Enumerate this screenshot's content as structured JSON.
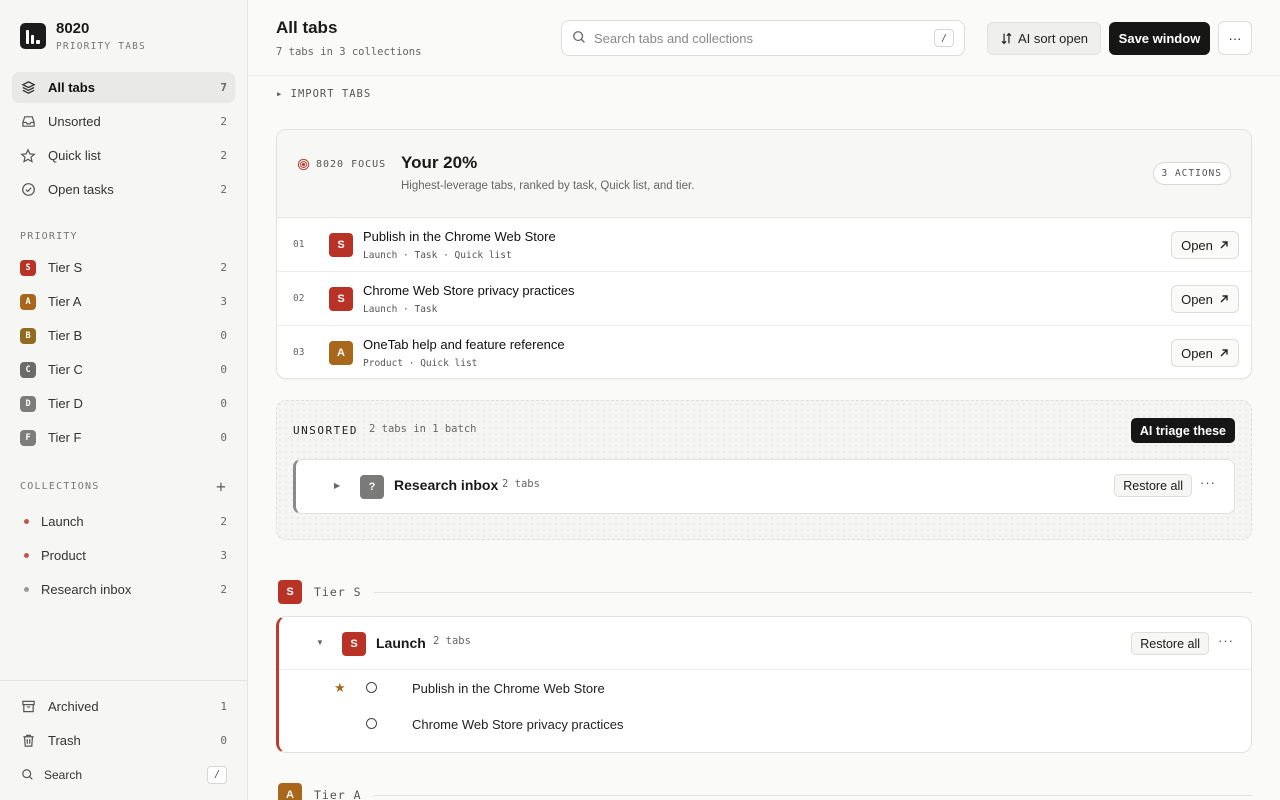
{
  "brand": {
    "name": "8020",
    "subtitle": "PRIORITY TABS"
  },
  "nav": [
    {
      "label": "All tabs",
      "count": "7",
      "icon": "layers-icon"
    },
    {
      "label": "Unsorted",
      "count": "2",
      "icon": "inbox-icon"
    },
    {
      "label": "Quick list",
      "count": "2",
      "icon": "star-icon"
    },
    {
      "label": "Open tasks",
      "count": "2",
      "icon": "check-circle-icon"
    }
  ],
  "priority": {
    "title": "PRIORITY",
    "tiers": [
      {
        "letter": "S",
        "label": "Tier S",
        "count": "2",
        "color": "#b83226"
      },
      {
        "letter": "A",
        "label": "Tier A",
        "count": "3",
        "color": "#a8671a"
      },
      {
        "letter": "B",
        "label": "Tier B",
        "count": "0",
        "color": "#8f6c1f"
      },
      {
        "letter": "C",
        "label": "Tier C",
        "count": "0",
        "color": "#6b6b69"
      },
      {
        "letter": "D",
        "label": "Tier D",
        "count": "0",
        "color": "#7d7d7b"
      },
      {
        "letter": "F",
        "label": "Tier F",
        "count": "0",
        "color": "#7d7d7b"
      }
    ]
  },
  "collections": {
    "title": "COLLECTIONS",
    "add": "+",
    "items": [
      {
        "label": "Launch",
        "count": "2",
        "color": "#c0574a"
      },
      {
        "label": "Product",
        "count": "3",
        "color": "#c0574a"
      },
      {
        "label": "Research inbox",
        "count": "2",
        "color": "#9a9a97"
      }
    ]
  },
  "bottom": {
    "archived": {
      "label": "Archived",
      "count": "1"
    },
    "trash": {
      "label": "Trash",
      "count": "0"
    },
    "search": {
      "label": "Search",
      "kbd": "/"
    }
  },
  "header": {
    "title": "All tabs",
    "subtitle": "7 tabs in 3 collections",
    "search_placeholder": "Search tabs and collections",
    "search_kbd": "/",
    "sort_label": "AI sort open",
    "save_label": "Save window",
    "more": "···"
  },
  "import_label": "▸ IMPORT TABS",
  "focus": {
    "tag": "8020 FOCUS",
    "title": "Your 20%",
    "description": "Highest-leverage tabs, ranked by task, Quick list, and tier.",
    "actions": "3 ACTIONS",
    "open_label": "Open",
    "rows": [
      {
        "num": "01",
        "tier": "S",
        "color": "#b83226",
        "title": "Publish in the Chrome Web Store",
        "meta": "Launch · Task · Quick list"
      },
      {
        "num": "02",
        "tier": "S",
        "color": "#b83226",
        "title": "Chrome Web Store privacy practices",
        "meta": "Launch · Task"
      },
      {
        "num": "03",
        "tier": "A",
        "color": "#a8671a",
        "title": "OneTab help and feature reference",
        "meta": "Product · Quick list"
      }
    ]
  },
  "unsorted": {
    "label": "UNSORTED",
    "sub": "2 tabs in 1 batch",
    "triage": "AI triage these",
    "batch": {
      "badge": "?",
      "title": "Research inbox",
      "count": "2 tabs",
      "restore": "Restore all",
      "more": "···"
    }
  },
  "tier_s": {
    "letter": "S",
    "label": "Tier S",
    "color": "#b83226"
  },
  "launch": {
    "badge": "S",
    "title": "Launch",
    "count": "2 tabs",
    "restore": "Restore all",
    "more": "···",
    "tabs": [
      {
        "title": "Publish in the Chrome Web Store",
        "starred": true
      },
      {
        "title": "Chrome Web Store privacy practices",
        "starred": false
      }
    ]
  },
  "tier_a": {
    "letter": "A",
    "label": "Tier A",
    "color": "#a8671a"
  }
}
